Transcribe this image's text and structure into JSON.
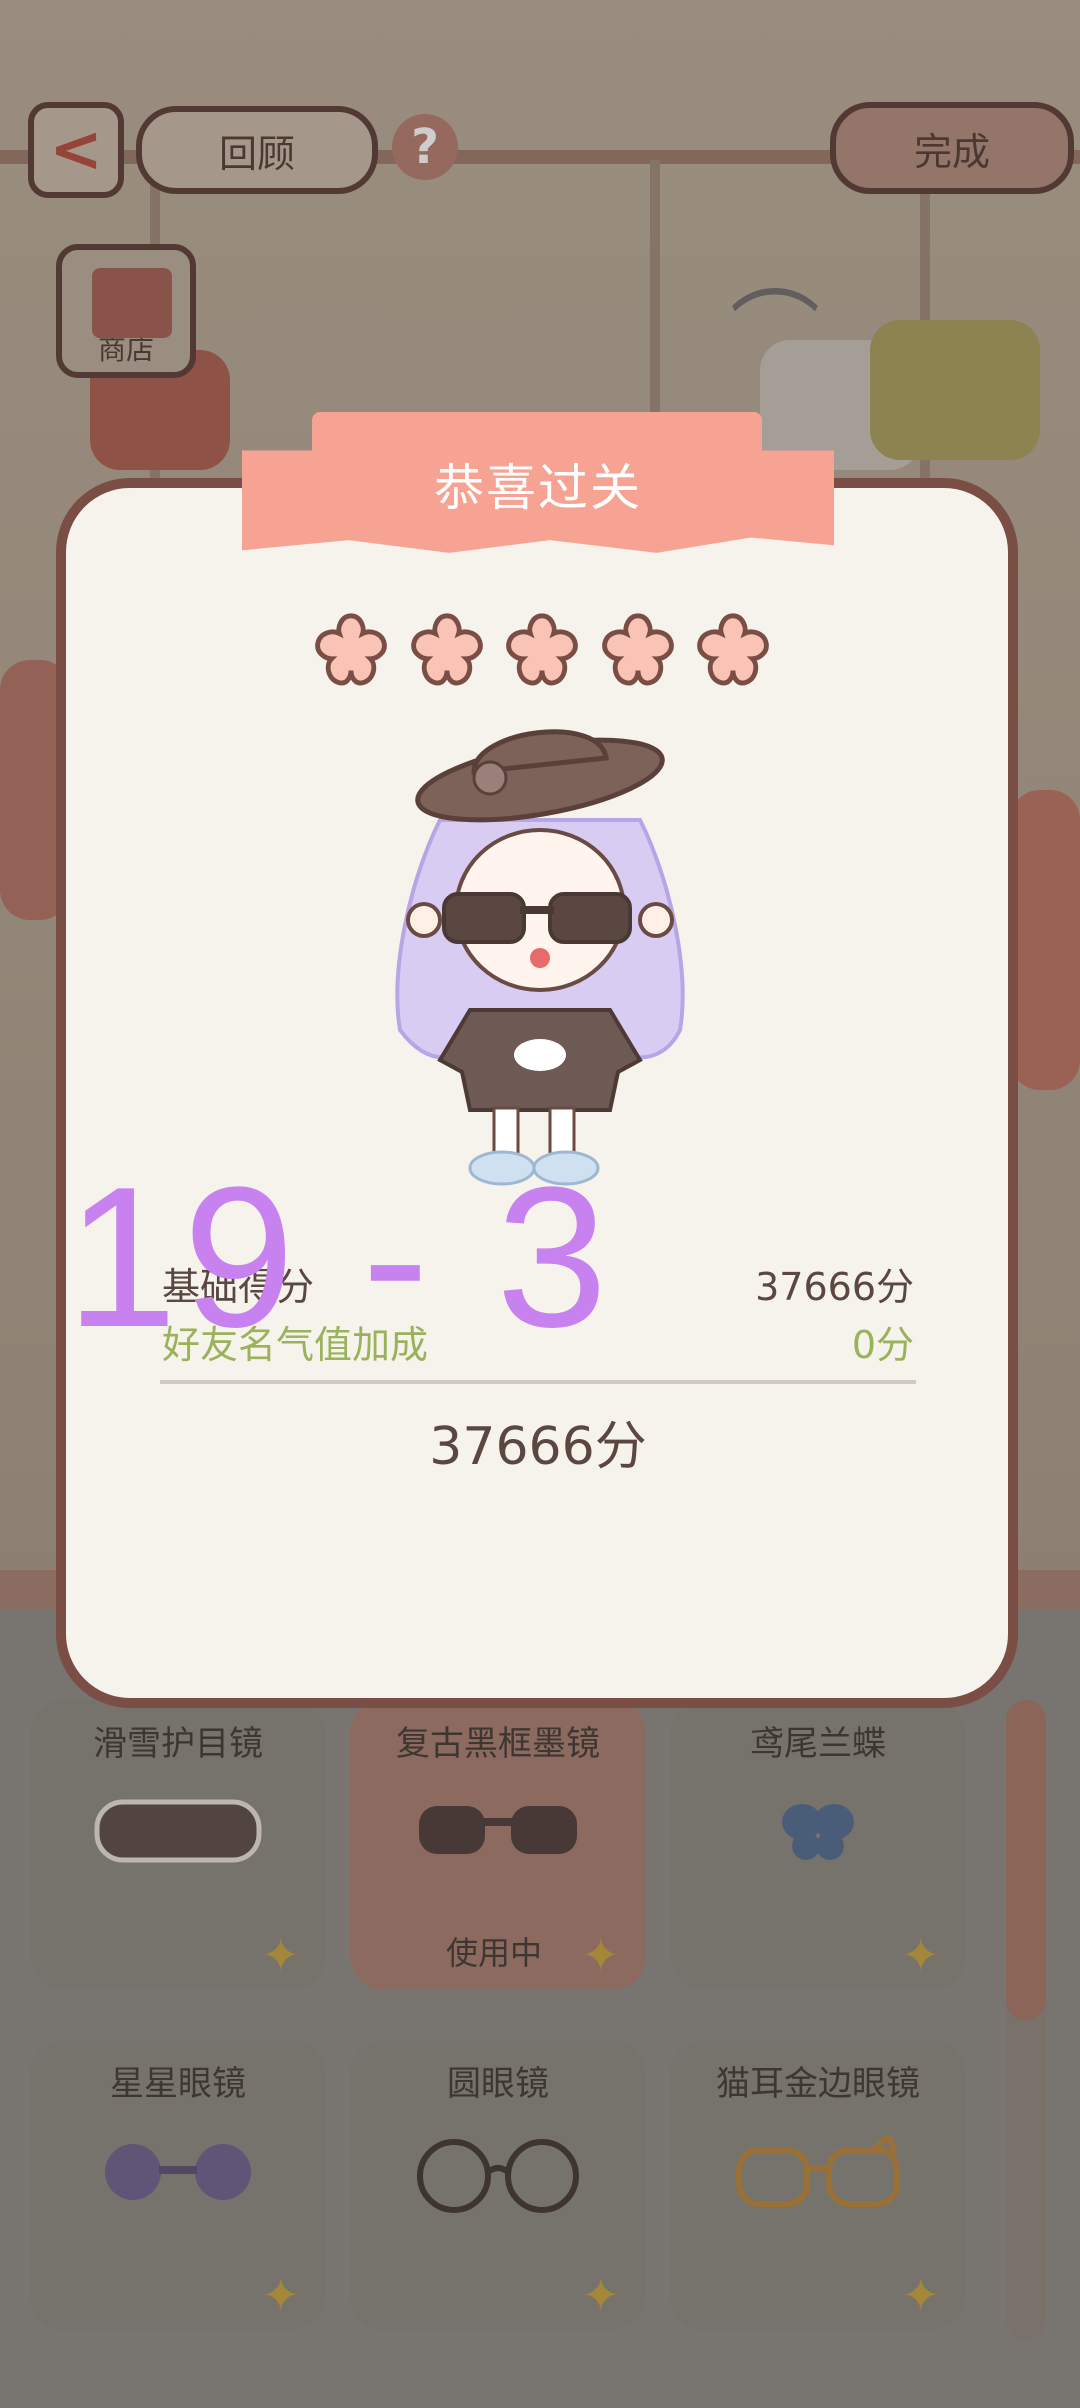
{
  "topbar": {
    "review_label": "回顾",
    "help_label": "?",
    "done_label": "完成",
    "back_label": "<"
  },
  "shop": {
    "label": "商店"
  },
  "dialog": {
    "banner": "恭喜过关",
    "stars": 5,
    "score_rows": [
      {
        "label": "基础得分",
        "value": "37666分"
      },
      {
        "label": "好友名气值加成",
        "value": "0分"
      }
    ],
    "total": "37666分"
  },
  "level_overlay": "19 - 3",
  "items": [
    {
      "name": "滑雪护目镜",
      "status": "",
      "icon": "goggles-icon"
    },
    {
      "name": "复古黑框墨镜",
      "status": "使用中",
      "icon": "sunglasses-icon"
    },
    {
      "name": "鸢尾兰蝶",
      "status": "",
      "icon": "butterfly-icon"
    },
    {
      "name": "星星眼镜",
      "status": "",
      "icon": "flower-glasses-icon"
    },
    {
      "name": "圆眼镜",
      "status": "",
      "icon": "round-glasses-icon"
    },
    {
      "name": "猫耳金边眼镜",
      "status": "",
      "icon": "cat-glasses-icon"
    }
  ],
  "colors": {
    "accent": "#f7a393",
    "frame": "#7a4e45",
    "friend_bonus": "#9ab25a",
    "overlay": "#c882f0"
  }
}
